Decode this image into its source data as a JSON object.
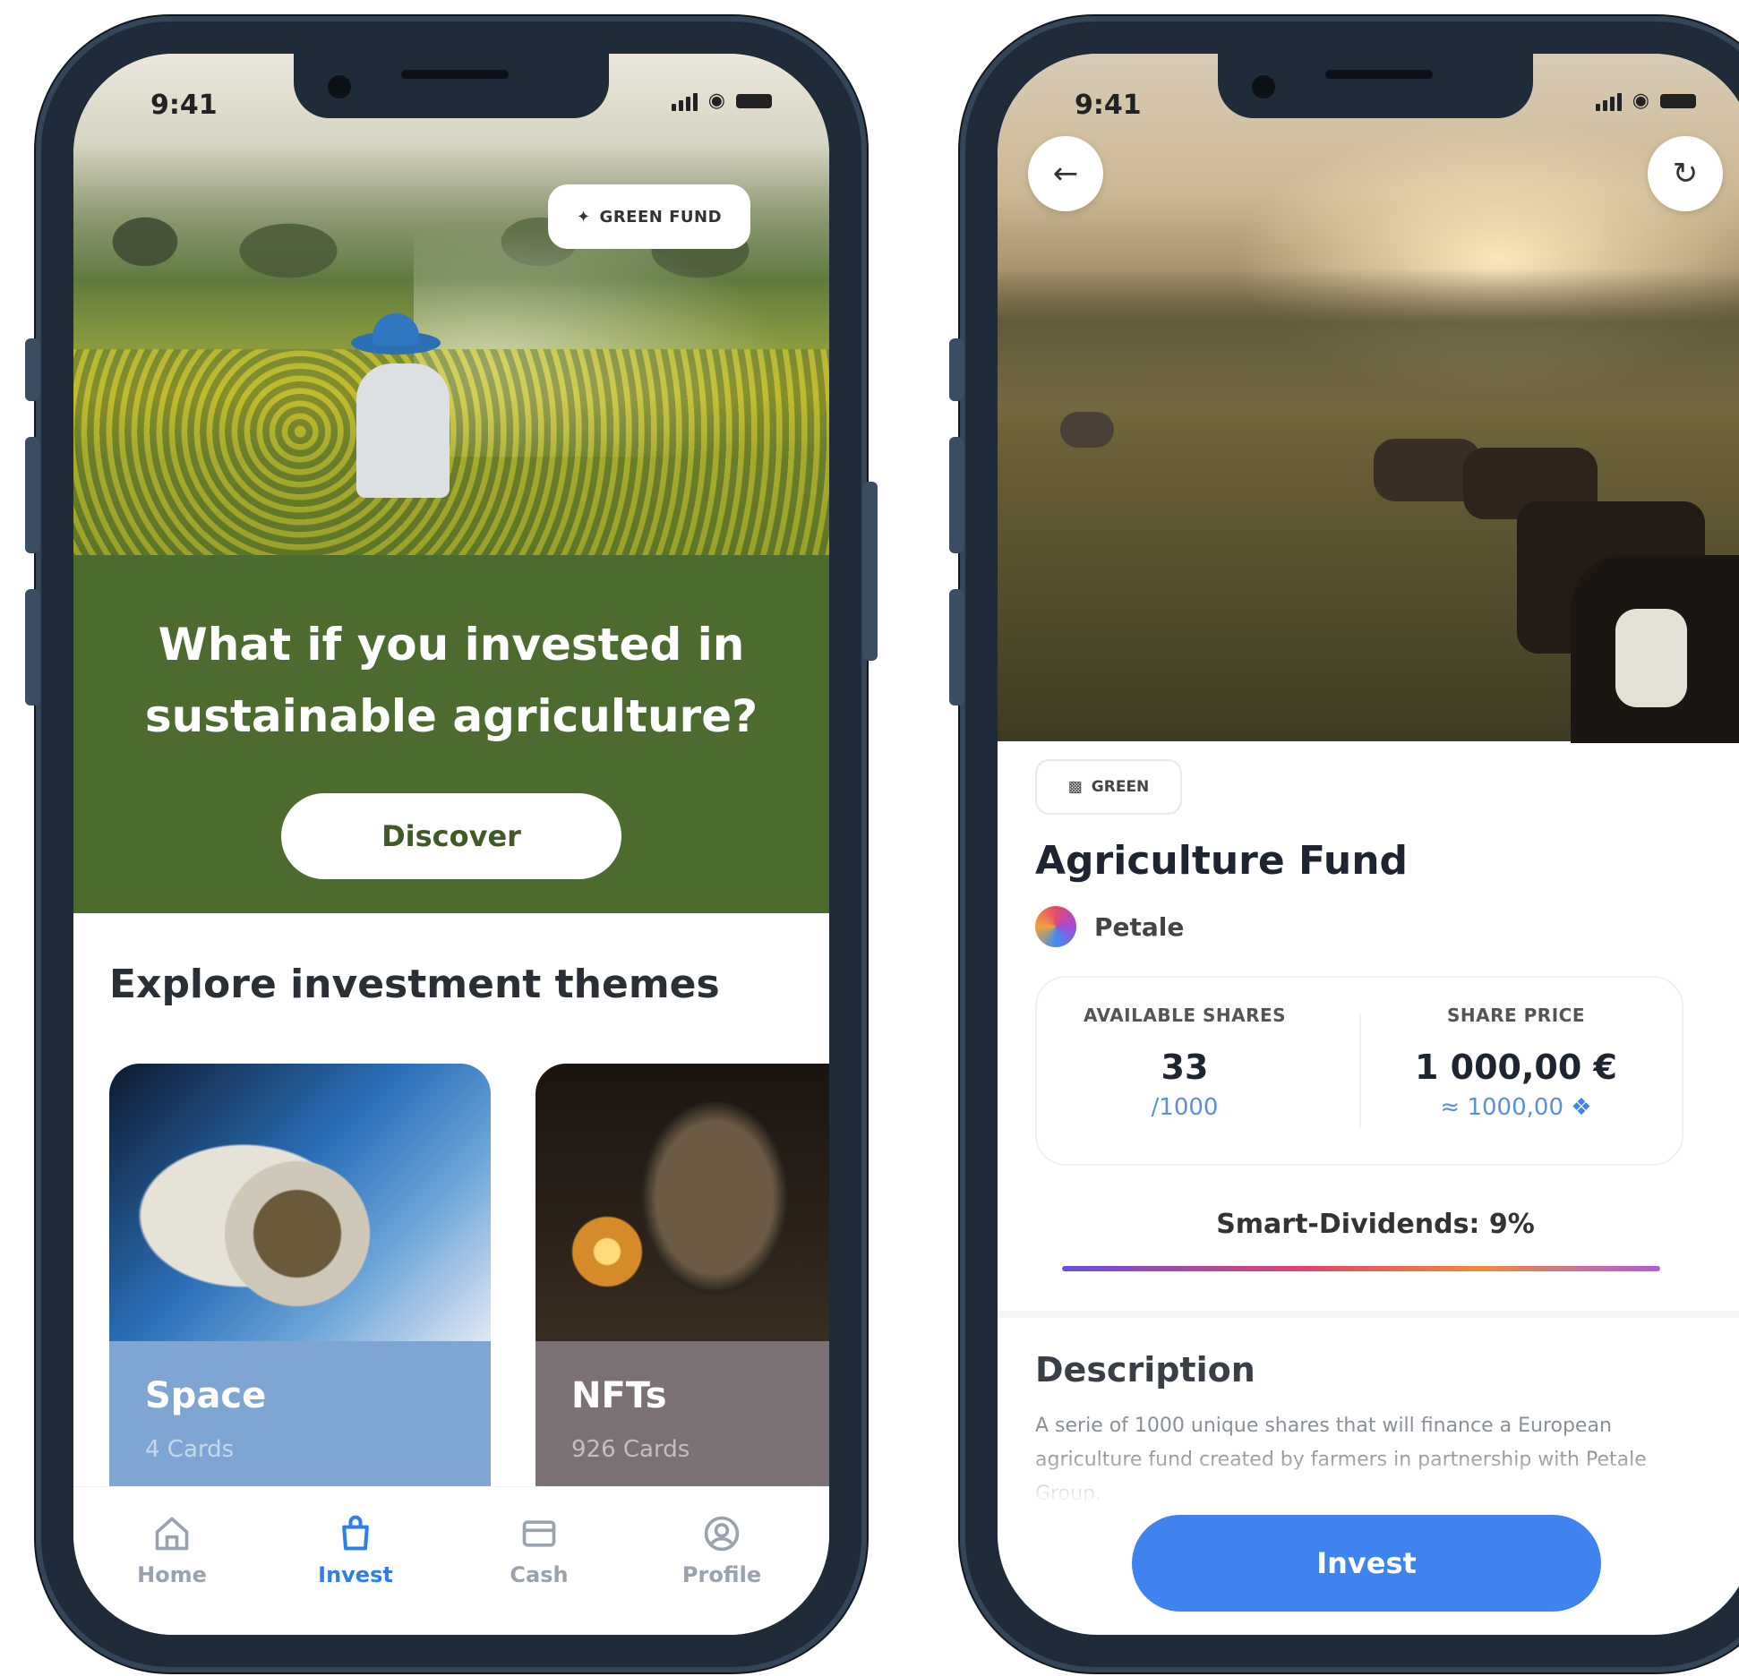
{
  "phone1": {
    "status": {
      "time": "9:41"
    },
    "hero": {
      "badge": "GREEN FUND"
    },
    "promo": {
      "headline": "What if you invested in sustainable agriculture?",
      "button": "Discover"
    },
    "explore": {
      "title": "Explore investment themes",
      "cards": [
        {
          "name": "Space",
          "count": "4 Cards",
          "color": "#7fa6d2"
        },
        {
          "name": "NFTs",
          "count": "926 Cards",
          "color": "#7b7073"
        }
      ]
    },
    "tabbar": {
      "active": "Invest",
      "tabs": [
        {
          "label": "Home",
          "icon": "home-icon"
        },
        {
          "label": "Invest",
          "icon": "invest-bag-icon"
        },
        {
          "label": "Cash",
          "icon": "card-icon"
        },
        {
          "label": "Profile",
          "icon": "profile-icon"
        }
      ]
    }
  },
  "phone2": {
    "status": {
      "time": "9:41"
    },
    "tag": "GREEN",
    "title": "Agriculture Fund",
    "issuer": "Petale",
    "stats": {
      "available_label": "AVAILABLE SHARES",
      "available_value": "33",
      "available_total": "/1000",
      "price_label": "SHARE PRICE",
      "price_value": "1 000,00 €",
      "price_alt": "≈ 1000,00"
    },
    "dividends": "Smart-Dividends: 9%",
    "description": {
      "title": "Description",
      "text": "A serie of 1000 unique shares that will finance a European agriculture fund created by farmers in partnership with Petale Group."
    },
    "invest_button": "Invest"
  },
  "colors": {
    "accent_blue": "#3f83ee",
    "promo_green": "#4d6b2f",
    "phone_frame": "#1f2b38"
  }
}
